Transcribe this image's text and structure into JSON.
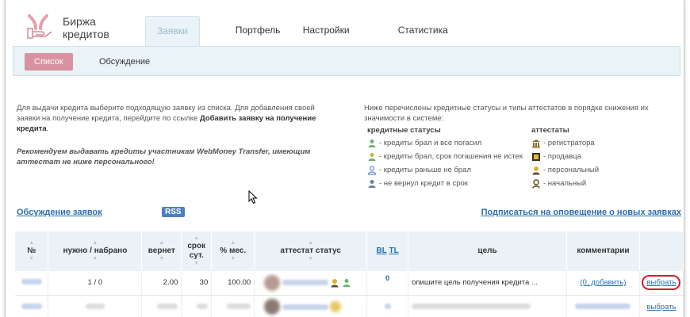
{
  "logo": {
    "line1": "Биржа",
    "line2": "кредитов"
  },
  "tabs": [
    "Заявки",
    "Портфель",
    "Настройки",
    "Статистика"
  ],
  "subnav": {
    "active": "Список",
    "other": "Обсуждение"
  },
  "info_left": {
    "p1_start": "Для выдачи кредита выберите подходящую заявку из списка. Для добавления своей заявки на получение кредита, перейдите по ссылке ",
    "p1_link": "Добавить заявку на получение кредита",
    "p1_end": ".",
    "recommend": "Рекомендуем выдавать кредиты участникам WebMoney Transfer, имеющим аттестат не ниже персонального!"
  },
  "info_right": {
    "intro": "Ниже перечислены кредитные статусы и типы аттестатов в порядке снижения их значимости в системе:",
    "statuses_head": "кредитные статусы",
    "attestats_head": "аттестаты",
    "statuses": [
      {
        "icon": "person-green-icon",
        "text": "- кредиты брал и все погасил"
      },
      {
        "icon": "person-yellow-icon",
        "text": "- кредиты брал, срок погашения не истек"
      },
      {
        "icon": "person-blue-icon",
        "text": "- кредиты раньше не брал"
      },
      {
        "icon": "person-gray-icon",
        "text": "- не вернул кредит в срок"
      }
    ],
    "attestats": [
      {
        "icon": "registrar-icon",
        "text": "- регистратора"
      },
      {
        "icon": "seller-icon",
        "text": "- продавца"
      },
      {
        "icon": "personal-icon",
        "text": "- персональный"
      },
      {
        "icon": "initial-icon",
        "text": "- начальный"
      }
    ]
  },
  "links": {
    "discussion": "Обсуждение заявок",
    "rss": "RSS",
    "subscribe": "Подписаться на оповещение о новых заявках"
  },
  "table": {
    "headers": {
      "num": "№",
      "need": "нужно / набрано",
      "ret": "вернет",
      "term1": "срок",
      "term2": "сут.",
      "pct": "% мес.",
      "att": "аттестат статус",
      "bl": "BL",
      "tl": "TL",
      "goal": "цель",
      "comments": "комментарии"
    },
    "rows": [
      {
        "need": "1 / 0",
        "ret": "2.00",
        "term": "30",
        "pct": "100.00",
        "bl": "0",
        "goal": "опишите цель получения кредита ...",
        "comments": "(0, добавить)",
        "action": "выбрать"
      },
      {
        "action": "выбрать"
      }
    ]
  },
  "colors": {
    "accent_pink": "#d9929f",
    "tab_bg": "#e9f3f8",
    "link_blue": "#2a6fb0",
    "circle_red": "#d32030"
  }
}
